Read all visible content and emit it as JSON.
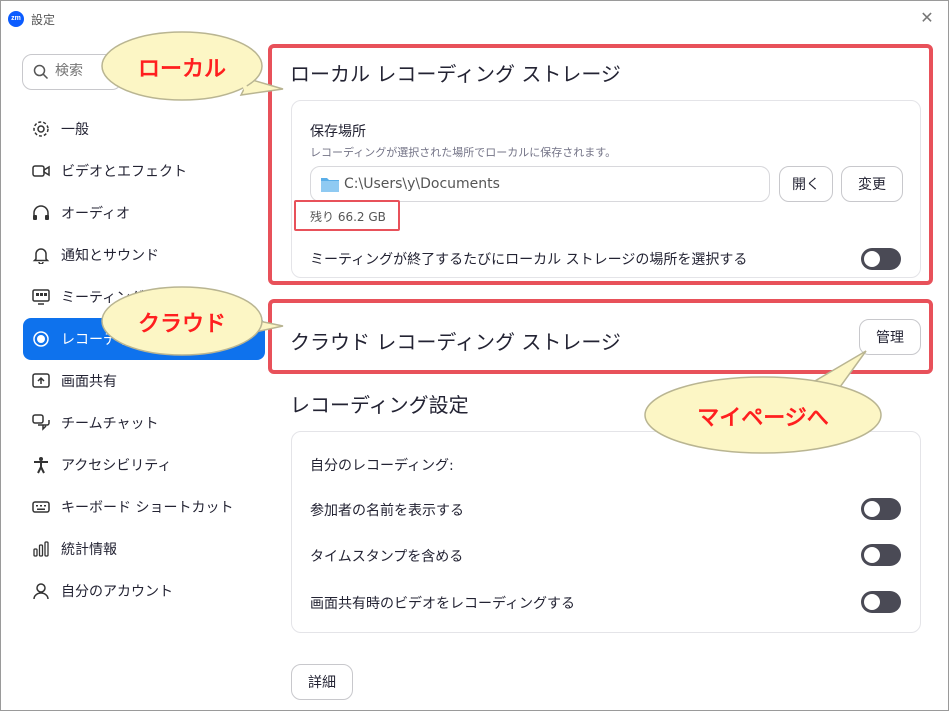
{
  "window": {
    "app_logo": "zm",
    "title": "設定",
    "close": "✕"
  },
  "search": {
    "placeholder": "検索"
  },
  "sidebar": {
    "items": [
      {
        "label": "一般",
        "icon": "gear-icon"
      },
      {
        "label": "ビデオとエフェクト",
        "icon": "video-icon"
      },
      {
        "label": "オーディオ",
        "icon": "headphones-icon"
      },
      {
        "label": "通知とサウンド",
        "icon": "bell-icon"
      },
      {
        "label": "ミーティング",
        "icon": "meeting-icon"
      },
      {
        "label": "レコーディング",
        "icon": "record-icon"
      },
      {
        "label": "画面共有",
        "icon": "share-screen-icon"
      },
      {
        "label": "チームチャット",
        "icon": "chat-icon"
      },
      {
        "label": "アクセシビリティ",
        "icon": "accessibility-icon"
      },
      {
        "label": "キーボード ショートカット",
        "icon": "keyboard-icon"
      },
      {
        "label": "統計情報",
        "icon": "stats-icon"
      },
      {
        "label": "自分のアカウント",
        "icon": "account-icon"
      }
    ],
    "active_index": 5
  },
  "local": {
    "title": "ローカル レコーディング ストレージ",
    "location_label": "保存場所",
    "location_sub": "レコーディングが選択された場所でローカルに保存されます。",
    "path": "C:\\Users\\y\\Documents",
    "open_label": "開く",
    "change_label": "変更",
    "remaining": "残り 66.2 GB",
    "choose_each_time": "ミーティングが終了するたびにローカル ストレージの場所を選択する"
  },
  "cloud": {
    "title": "クラウド レコーディング ストレージ",
    "manage_label": "管理"
  },
  "settings": {
    "title": "レコーディング設定",
    "my_recording": "自分のレコーディング:",
    "show_names": "参加者の名前を表示する",
    "timestamps": "タイムスタンプを含める",
    "record_video_share": "画面共有時のビデオをレコーディングする",
    "details_label": "詳細"
  },
  "annotations": {
    "local": "ローカル",
    "cloud": "クラウド",
    "mypage": "マイページへ"
  },
  "colors": {
    "accent": "#0e72ed",
    "annotation_red": "#e8515a",
    "callout_fill": "#fcf6c5",
    "callout_text": "#ff1f1f",
    "toggle_off": "#4a4a55"
  }
}
